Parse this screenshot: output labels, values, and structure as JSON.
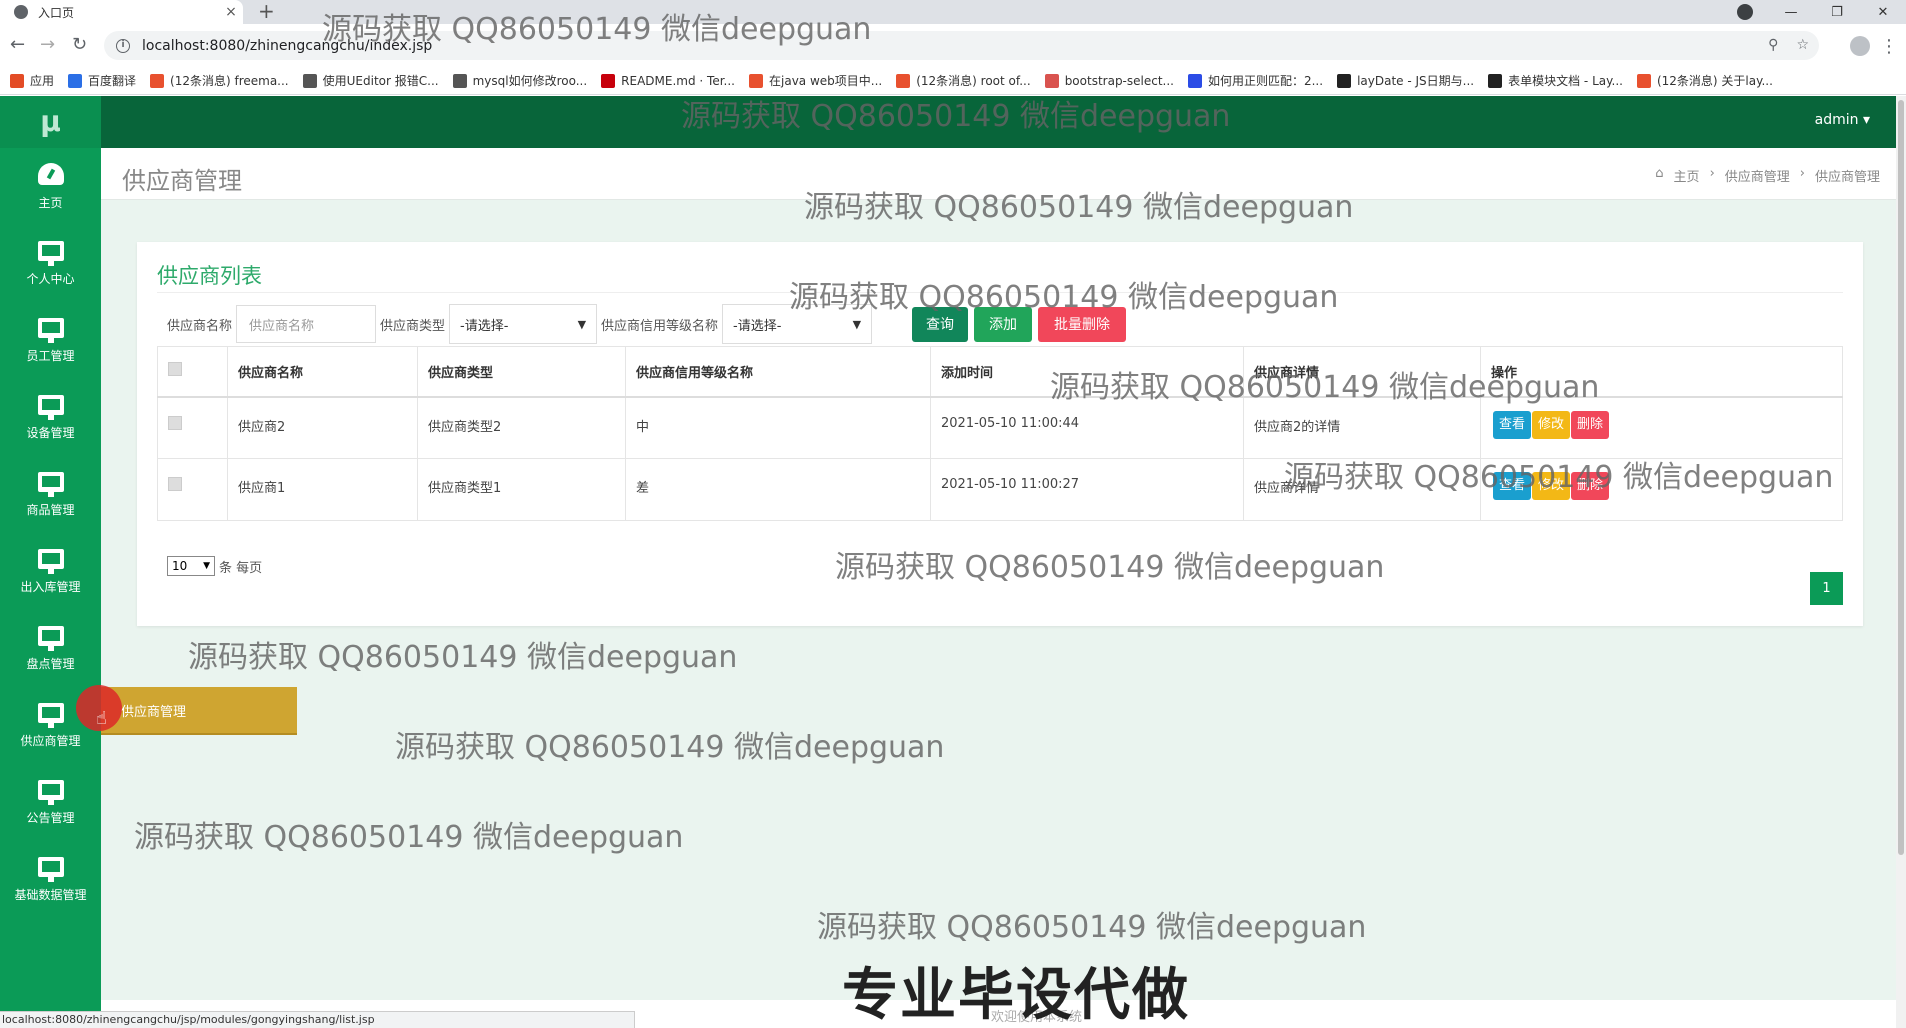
{
  "browser": {
    "tab_title": "入口页",
    "tab_close": "×",
    "new_tab": "+",
    "url": "localhost:8080/zhinengcangchu/index.jsp",
    "bookmarks": [
      {
        "label": "应用",
        "color": "#e34c26"
      },
      {
        "label": "百度翻译",
        "color": "#2b6fe6"
      },
      {
        "label": "(12条消息) freema...",
        "color": "#e8512f"
      },
      {
        "label": "使用UEditor 报错C...",
        "color": "#555555"
      },
      {
        "label": "mysql如何修改roo...",
        "color": "#555555"
      },
      {
        "label": "README.md · Ter...",
        "color": "#c7000b"
      },
      {
        "label": "在java web项目中...",
        "color": "#e8512f"
      },
      {
        "label": "(12条消息) root of...",
        "color": "#e8512f"
      },
      {
        "label": "bootstrap-select...",
        "color": "#d9534f"
      },
      {
        "label": "如何用正则匹配：2...",
        "color": "#2b4ce6"
      },
      {
        "label": "layDate - JS日期与...",
        "color": "#222222"
      },
      {
        "label": "表单模块文档 - Lay...",
        "color": "#222222"
      },
      {
        "label": "(12条消息) 关于lay...",
        "color": "#e8512f"
      }
    ],
    "status_url": "localhost:8080/zhinengcangchu/jsp/modules/gongyingshang/list.jsp"
  },
  "app": {
    "logo": "μ",
    "admin_label": "admin ▾",
    "sidebar": [
      {
        "label": "主页",
        "icon": "dashboard-icon"
      },
      {
        "label": "个人中心",
        "icon": "monitor-icon"
      },
      {
        "label": "员工管理",
        "icon": "monitor-icon"
      },
      {
        "label": "设备管理",
        "icon": "monitor-icon"
      },
      {
        "label": "商品管理",
        "icon": "monitor-icon"
      },
      {
        "label": "出入库管理",
        "icon": "monitor-icon"
      },
      {
        "label": "盘点管理",
        "icon": "monitor-icon"
      },
      {
        "label": "供应商管理",
        "icon": "monitor-icon"
      },
      {
        "label": "公告管理",
        "icon": "monitor-icon"
      },
      {
        "label": "基础数据管理",
        "icon": "monitor-icon"
      }
    ],
    "hover_menu": "供应商管理",
    "page_title": "供应商管理",
    "breadcrumb": [
      "主页",
      "供应商管理",
      "供应商管理"
    ],
    "card_title": "供应商列表",
    "filters": {
      "name_label": "供应商名称",
      "name_placeholder": "供应商名称",
      "type_label": "供应商类型",
      "type_value": "-请选择-",
      "credit_label": "供应商信用等级名称",
      "credit_value": "-请选择-"
    },
    "buttons": {
      "query": "查询",
      "add": "添加",
      "batch_delete": "批量删除"
    },
    "table": {
      "headers": [
        "供应商名称",
        "供应商类型",
        "供应商信用等级名称",
        "添加时间",
        "供应商详情",
        "操作"
      ],
      "rows": [
        {
          "name": "供应商2",
          "type": "供应商类型2",
          "credit": "中",
          "time": "2021-05-10 11:00:44",
          "detail": "供应商2的详情"
        },
        {
          "name": "供应商1",
          "type": "供应商类型1",
          "credit": "差",
          "time": "2021-05-10 11:00:27",
          "detail": "供应商详情"
        }
      ],
      "actions": {
        "view": "查看",
        "edit": "修改",
        "delete": "删除"
      }
    },
    "pager": {
      "page_size": "10",
      "per_page_label": "条 每页",
      "current_page": "1"
    },
    "footer_text": "欢迎使用本系统"
  },
  "watermark": "源码获取 QQ86050149 微信deepguan",
  "banner": "专业毕设代做"
}
